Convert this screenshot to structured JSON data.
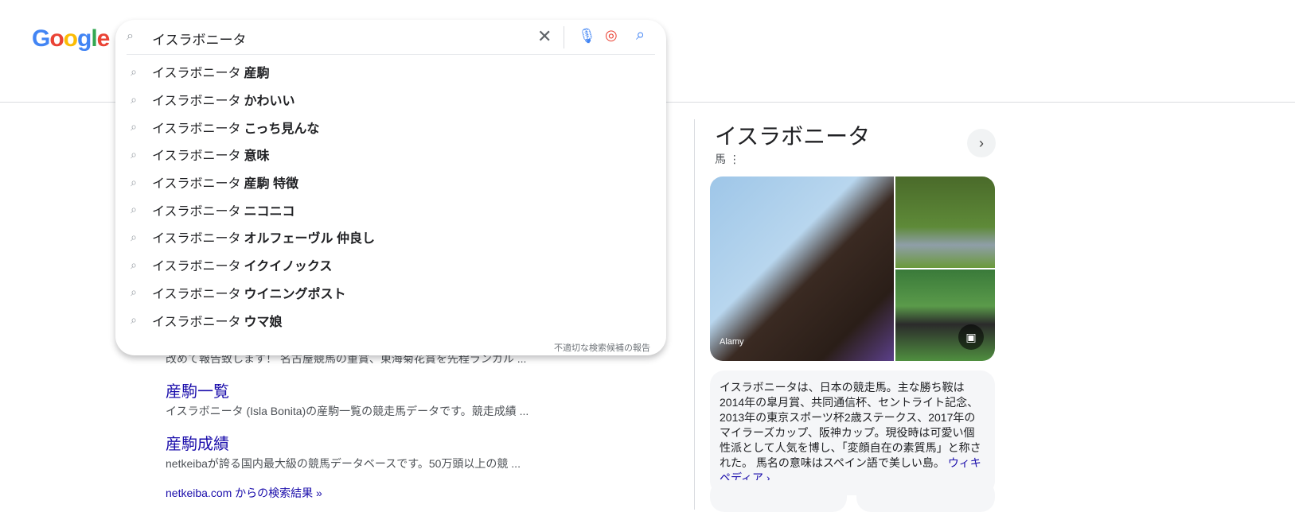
{
  "logo": [
    "G",
    "o",
    "o",
    "g",
    "l",
    "e"
  ],
  "search": {
    "query": "イスラボニータ",
    "report_label": "不適切な検索候補の報告"
  },
  "suggestions": [
    {
      "prefix": "イスラボニータ",
      "bold": "産駒"
    },
    {
      "prefix": "イスラボニータ",
      "bold": "かわいい"
    },
    {
      "prefix": "イスラボニータ",
      "bold": "こっち見んな"
    },
    {
      "prefix": "イスラボニータ",
      "bold": "意味"
    },
    {
      "prefix": "イスラボニータ",
      "bold": "産駒 特徴"
    },
    {
      "prefix": "イスラボニータ",
      "bold": "ニコニコ"
    },
    {
      "prefix": "イスラボニータ",
      "bold": "オルフェーヴル 仲良し"
    },
    {
      "prefix": "イスラボニータ",
      "bold": "イクイノックス"
    },
    {
      "prefix": "イスラボニータ",
      "bold": "ウイニングポスト"
    },
    {
      "prefix": "イスラボニータ",
      "bold": "ウマ娘"
    }
  ],
  "results": {
    "partial_snippet": "改めて報告致します！ 名古屋競馬の重賞、東海菊花賞を先程ランカル ...",
    "items": [
      {
        "title": "産駒一覧",
        "snippet": "イスラボニータ (Isla Bonita)の産駒一覧の競走馬データです。競走成績 ..."
      },
      {
        "title": "産駒成績",
        "snippet": "netkeibaが誇る国内最大級の競馬データベースです。50万頭以上の競 ..."
      }
    ],
    "more_link": "netkeiba.com からの検索結果 »"
  },
  "knowledge_panel": {
    "title": "イスラボニータ",
    "subtitle": "馬",
    "image_credit": "Alamy",
    "description": "イスラボニータは、日本の競走馬。主な勝ち鞍は2014年の皐月賞、共同通信杯、セントライト記念、2013年の東京スポーツ杯2歳ステークス、2017年のマイラーズカップ、阪神カップ。現役時は可愛い個性派として人気を博し、「変顔自在の素質馬」と称された。 馬名の意味はスペイン語で美しい島。",
    "wiki_link": "ウィキペディア ›"
  }
}
